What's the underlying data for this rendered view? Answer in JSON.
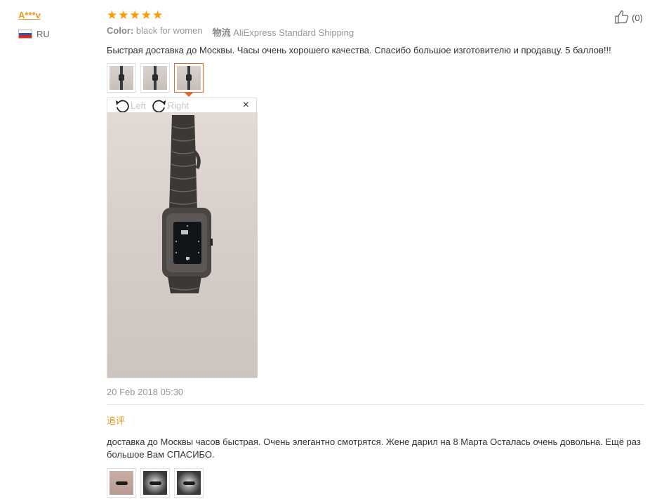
{
  "user": {
    "name": "A***v",
    "country": "RU"
  },
  "review": {
    "rating": 5,
    "likes": "(0)",
    "color_key": "Color:",
    "color_value": "black for women",
    "shipping_key": "物流",
    "shipping_value": "AliExpress Standard Shipping",
    "text": "Быстрая доставка до Москвы. Часы очень хорошего качества. Спасибо большое изготовителю и продавцу. 5 баллов!!!",
    "date": "20 Feb 2018 05:30"
  },
  "viewer": {
    "rotate_left": "Left",
    "rotate_right": "Right",
    "close": "×"
  },
  "followup": {
    "title": "追评",
    "text": "доставка до Москвы часов быстрая. Очень элегантно смотрятся. Жене дарил на 8 Марта Осталась очень довольна. Ещё раз большое Вам СПАСИБО."
  },
  "colors": {
    "star": "#ff9a00",
    "accent": "#e89b1f",
    "active_border": "#e4682c"
  }
}
